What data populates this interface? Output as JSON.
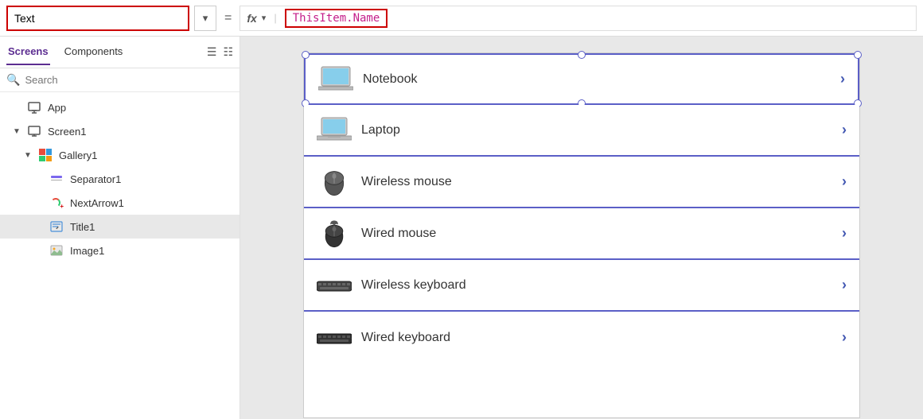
{
  "topbar": {
    "text_field_label": "Text",
    "text_field_value": "Text",
    "dropdown_arrow": "▾",
    "equals": "=",
    "fx_label": "fx",
    "formula_chevron": "▾",
    "formula_value": "ThisItem.Name"
  },
  "sidebar": {
    "tab_screens": "Screens",
    "tab_components": "Components",
    "search_placeholder": "Search",
    "tree_items": [
      {
        "id": "app",
        "label": "App",
        "indent": 1,
        "icon": "app-icon",
        "chevron": ""
      },
      {
        "id": "screen1",
        "label": "Screen1",
        "indent": 1,
        "icon": "screen-icon",
        "chevron": "▼"
      },
      {
        "id": "gallery1",
        "label": "Gallery1",
        "indent": 2,
        "icon": "gallery-icon",
        "chevron": "▼"
      },
      {
        "id": "separator1",
        "label": "Separator1",
        "indent": 3,
        "icon": "separator-icon",
        "chevron": ""
      },
      {
        "id": "nextarrow1",
        "label": "NextArrow1",
        "indent": 3,
        "icon": "nextarrow-icon",
        "chevron": ""
      },
      {
        "id": "title1",
        "label": "Title1",
        "indent": 3,
        "icon": "title-icon",
        "chevron": "",
        "selected": true
      },
      {
        "id": "image1",
        "label": "Image1",
        "indent": 3,
        "icon": "image-icon",
        "chevron": ""
      }
    ]
  },
  "gallery": {
    "items": [
      {
        "id": "notebook",
        "label": "Notebook",
        "device": "notebook"
      },
      {
        "id": "laptop",
        "label": "Laptop",
        "device": "laptop"
      },
      {
        "id": "wireless-mouse",
        "label": "Wireless mouse",
        "device": "wireless-mouse"
      },
      {
        "id": "wired-mouse",
        "label": "Wired mouse",
        "device": "wired-mouse"
      },
      {
        "id": "wireless-keyboard",
        "label": "Wireless keyboard",
        "device": "wireless-keyboard"
      },
      {
        "id": "wired-keyboard",
        "label": "Wired keyboard",
        "device": "wired-keyboard"
      }
    ]
  },
  "colors": {
    "accent": "#5b5fc7",
    "tab_active": "#5c2d91",
    "formula_color": "#c41e8a",
    "border_red": "#cc0000"
  }
}
